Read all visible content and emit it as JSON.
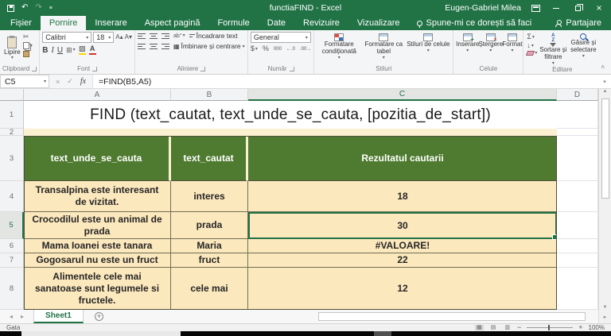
{
  "titlebar": {
    "title": "functiaFIND - Excel",
    "user": "Eugen-Gabriel Milea"
  },
  "tabs": {
    "file": "Fișier",
    "home": "Pornire",
    "insert": "Inserare",
    "layout": "Aspect pagină",
    "formulas": "Formule",
    "data": "Date",
    "review": "Revizuire",
    "view": "Vizualizare",
    "tellme": "Spune-mi ce dorești să faci",
    "share": "Partajare"
  },
  "ribbon": {
    "clipboard": {
      "label": "Clipboard",
      "paste": "Lipire"
    },
    "font": {
      "label": "Font",
      "name": "Calibri",
      "size": "18",
      "bold": "B",
      "italic": "I",
      "underline": "U"
    },
    "alignment": {
      "label": "Aliniere",
      "wrap": "Încadrare text",
      "merge": "Îmbinare și centrare"
    },
    "number": {
      "label": "Număr",
      "format": "General",
      "currency": "$",
      "percent": "%",
      "thousands": "000"
    },
    "styles": {
      "label": "Stiluri",
      "conditional": "Formatare condiționată",
      "as_table": "Formatare ca tabel",
      "cell_styles": "Stiluri de celule"
    },
    "cells": {
      "label": "Celule",
      "insert": "Inserare",
      "delete": "Ștergere",
      "format": "Format"
    },
    "editing": {
      "label": "Editare",
      "autosum": "Σ",
      "sort": "Sortare și filtrare",
      "find": "Găsire și selectare"
    }
  },
  "formula_bar": {
    "cell_ref": "C5",
    "fx": "fx",
    "formula": "=FIND(B5,A5)"
  },
  "grid": {
    "col_headers": [
      "A",
      "B",
      "C",
      "D"
    ],
    "row_headers": [
      "1",
      "2",
      "3",
      "4",
      "5",
      "6",
      "7",
      "8"
    ],
    "selected_cell": "C5",
    "title": "FIND (text_cautat, text_unde_se_cauta, [pozitia_de_start])",
    "table_headers": {
      "a": "text_unde_se_cauta",
      "b": "text_cautat",
      "c": "Rezultatul cautarii"
    },
    "rows": [
      {
        "a": "Transalpina este interesant de vizitat.",
        "b": "interes",
        "c": "18"
      },
      {
        "a": "Crocodilul este un animal de prada",
        "b": "prada",
        "c": "30"
      },
      {
        "a": "Mama Ioanei este tanara",
        "b": "Maria",
        "c": "#VALOARE!"
      },
      {
        "a": "Gogosarul nu este un fruct",
        "b": "fruct",
        "c": "22"
      },
      {
        "a": "Alimentele cele mai sanatoase sunt legumele si fructele.",
        "b": "cele mai",
        "c": "12"
      }
    ]
  },
  "sheet_bar": {
    "sheet": "Sheet1"
  },
  "status_bar": {
    "status": "Gata",
    "zoom": "100%"
  },
  "icons": {
    "undo": "↶",
    "redo": "↷",
    "scissors": "✂",
    "borders": "⊞",
    "check": "✓",
    "cancel": "×",
    "dropdown": "▾",
    "up_arrow": "▲",
    "down_arrow": "▼",
    "left_nav": "◂",
    "right_nav": "▸",
    "normal_view": "▦",
    "page_view": "▤",
    "break_view": "▥",
    "collapse": "˄",
    "font_up": "A▴",
    "font_down": "A▾",
    "fill_down": "↓",
    "minus": "−",
    "plus": "+",
    "orient": "ab°"
  },
  "colors": {
    "excel_green": "#217346",
    "table_header_green": "#4e7b2f",
    "cell_fill": "#fce8bd",
    "selection": "#217346"
  }
}
